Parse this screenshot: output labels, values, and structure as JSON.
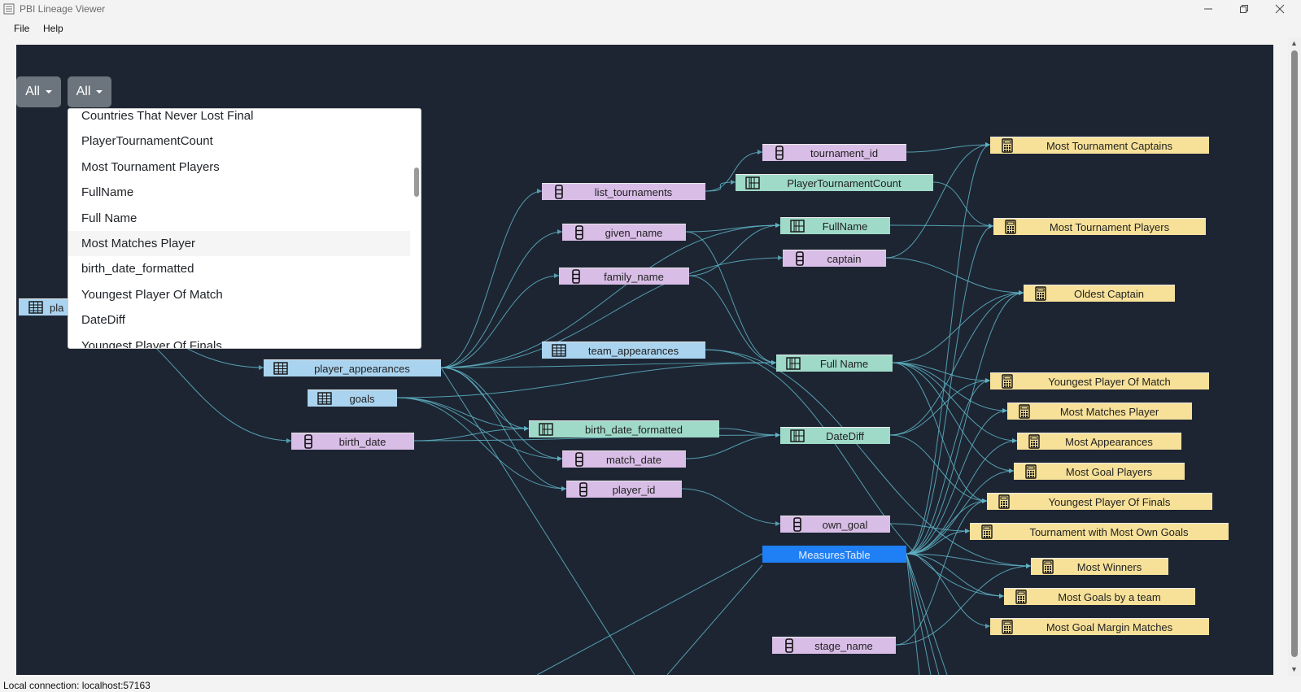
{
  "window": {
    "title": "PBI Lineage Viewer"
  },
  "menu": {
    "file": "File",
    "help": "Help"
  },
  "filters": {
    "first_label": "All",
    "second_label": "All"
  },
  "dropdown": {
    "items": [
      "Countries That Never Lost Final",
      "PlayerTournamentCount",
      "Most Tournament Players",
      "FullName",
      "Full Name",
      "Most Matches Player",
      "birth_date_formatted",
      "Youngest Player Of Match",
      "DateDiff",
      "Youngest Player Of Finals"
    ],
    "highlighted_item": "Most Matches Player"
  },
  "graph": {
    "nodes": {
      "players_partial": "pla",
      "player_appearances": "player_appearances",
      "goals": "goals",
      "birth_date": "birth_date",
      "list_tournaments": "list_tournaments",
      "given_name": "given_name",
      "family_name": "family_name",
      "team_appearances": "team_appearances",
      "birth_date_formatted": "birth_date_formatted",
      "match_date": "match_date",
      "player_id": "player_id",
      "tournament_id": "tournament_id",
      "PlayerTournamentCount": "PlayerTournamentCount",
      "FullName": "FullName",
      "captain": "captain",
      "Full Name": "Full Name",
      "DateDiff": "DateDiff",
      "own_goal": "own_goal",
      "MeasuresTable": "MeasuresTable",
      "stage_name": "stage_name",
      "Most Tournament Captains": "Most Tournament Captains",
      "Most Tournament Players": "Most Tournament Players",
      "Oldest Captain": "Oldest Captain",
      "Youngest Player Of Match": "Youngest Player Of Match",
      "Most Matches Player": "Most Matches Player",
      "Most Appearances": "Most Appearances",
      "Most Goal Players": "Most Goal Players",
      "Youngest Player Of Finals": "Youngest Player Of Finals",
      "Tournament with Most Own Goals": "Tournament with Most Own Goals",
      "Most Winners": "Most Winners",
      "Most Goals by a team": "Most Goals by a team",
      "Most Goal Margin Matches": "Most Goal Margin Matches"
    },
    "selected_node": "MeasuresTable",
    "colors": {
      "background": "#1d2533",
      "edge": "#5fb3c4",
      "column": "#d8bde6",
      "table": "#a9d3ef",
      "calculated": "#9fd9c8",
      "measure": "#f7e199",
      "selected": "#1f7ff5"
    }
  },
  "status": {
    "text": "Local connection: localhost:57163"
  }
}
